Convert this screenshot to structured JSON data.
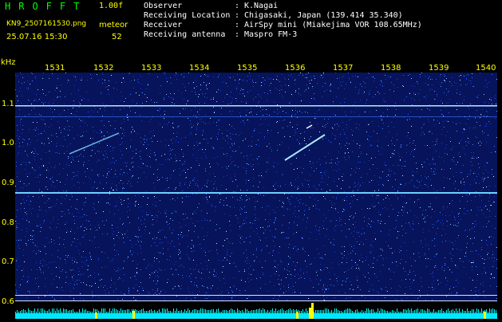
{
  "header": {
    "app_title": "HROFFT",
    "version": "1.00f",
    "filename": "KN9_2507161530.png",
    "mode_label": "meteor",
    "datetime": "25.07.16 15:30",
    "count": "52"
  },
  "info": [
    {
      "key": "Observer",
      "sep": ":",
      "value": "K.Nagai"
    },
    {
      "key": "Receiving Location",
      "sep": ":",
      "value": "Chigasaki, Japan (139.414 35.340)"
    },
    {
      "key": "Receiver",
      "sep": ":",
      "value": "AirSpy mini (Miakejima VOR 108.65MHz)"
    },
    {
      "key": "Receiving antenna",
      "sep": ":",
      "value": "Maspro FM-3"
    }
  ],
  "axes": {
    "y_unit": "kHz",
    "y_ticks": [
      "1.1",
      "1.0",
      "0.9",
      "0.8",
      "0.7",
      "0.6"
    ],
    "x_ticks": [
      "1531",
      "1532",
      "1533",
      "1534",
      "1535",
      "1536",
      "1537",
      "1538",
      "1539",
      "1540"
    ]
  },
  "colors": {
    "background": "#000000",
    "label": "#ffff00",
    "title": "#00ff00",
    "plot_background": "#07145c",
    "spectrum": "#00ffff"
  }
}
